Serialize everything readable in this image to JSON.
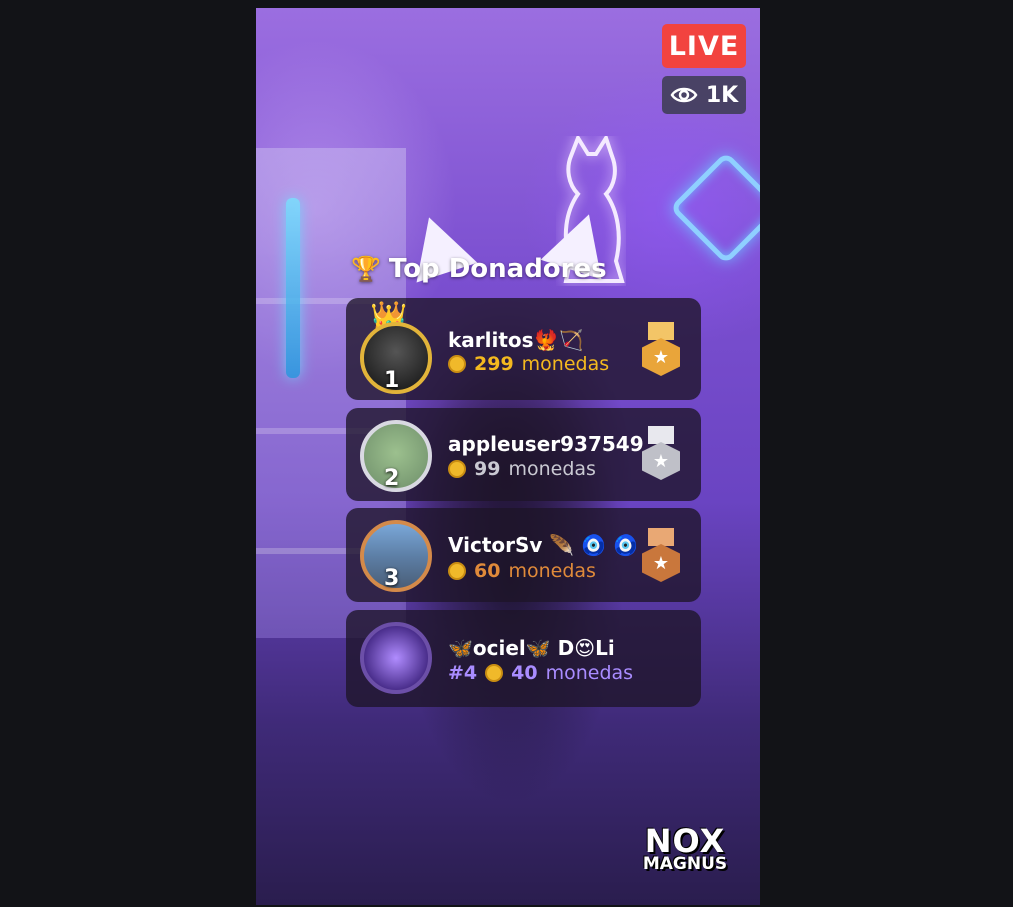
{
  "live": {
    "label": "LIVE"
  },
  "viewers": {
    "icon": "eye-icon",
    "count": "1K"
  },
  "panel": {
    "title": "Top Donadores",
    "icon": "trophy-icon"
  },
  "donors": [
    {
      "rank": "1",
      "name": "karlitos🐦‍🔥🏹",
      "amount": "299",
      "unit": "monedas",
      "color": "#f4b91f",
      "medal": "gold-medal-icon"
    },
    {
      "rank": "2",
      "name": "appleuser937549",
      "amount": "99",
      "unit": "monedas",
      "color": "#c9c9d2",
      "medal": "silver-medal-icon"
    },
    {
      "rank": "3",
      "name": "VictorSv 🪶 🧿 🧿",
      "amount": "60",
      "unit": "monedas",
      "color": "#e08a3a",
      "medal": "bronze-medal-icon"
    },
    {
      "rank": "#4",
      "name": "🦋ociel🦋 D😍Li",
      "amount": "40",
      "unit": "monedas",
      "color": "#a98cff"
    }
  ],
  "logo": {
    "line1": "NOX",
    "line2": "MAGNUS"
  },
  "colors": {
    "live": "#f2433f",
    "gold": "#e2b43a",
    "silver": "#d9d9e2",
    "bronze": "#d48a4a",
    "purple": "#a98cff"
  }
}
